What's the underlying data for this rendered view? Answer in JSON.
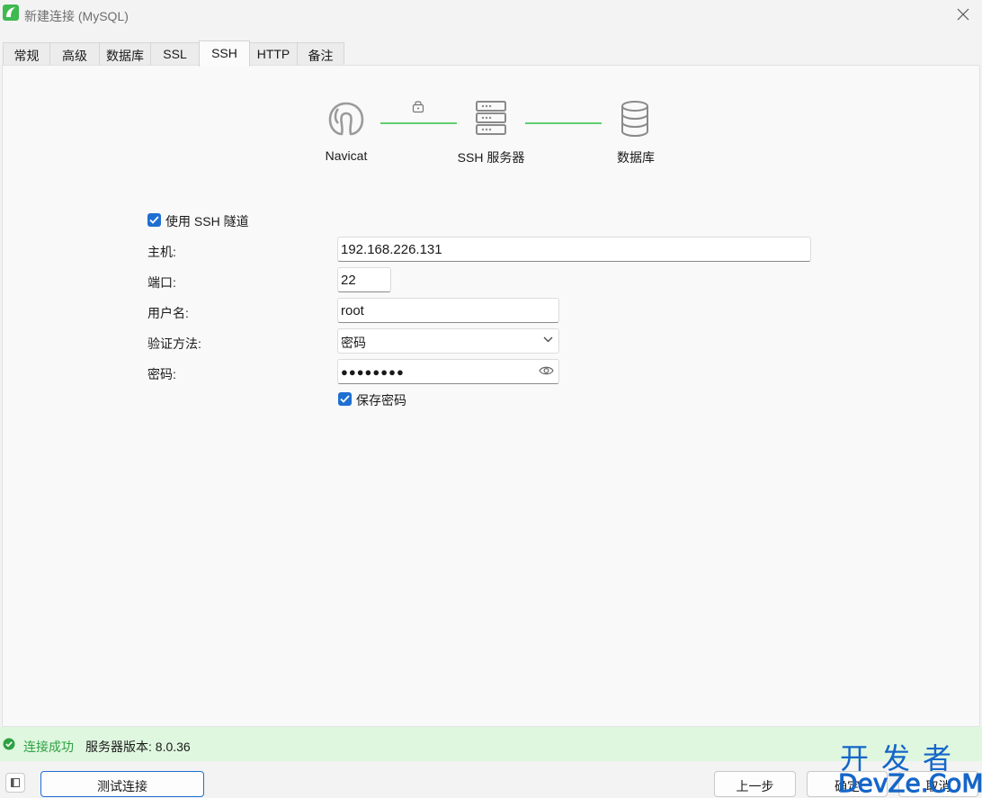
{
  "window": {
    "title": "新建连接 (MySQL)"
  },
  "tabs": [
    {
      "label": "常规"
    },
    {
      "label": "高级"
    },
    {
      "label": "数据库"
    },
    {
      "label": "SSL"
    },
    {
      "label": "SSH"
    },
    {
      "label": "HTTP"
    },
    {
      "label": "备注"
    }
  ],
  "active_tab": "SSH",
  "diagram": {
    "nodes": [
      {
        "label": "Navicat",
        "icon": "navicat-icon"
      },
      {
        "label": "SSH 服务器",
        "icon": "server-icon"
      },
      {
        "label": "数据库",
        "icon": "database-icon"
      }
    ],
    "link_icon": "lock-icon",
    "link_color": "#5fcf6f"
  },
  "form": {
    "use_ssh_label": "使用 SSH 隧道",
    "use_ssh_checked": true,
    "host_label": "主机:",
    "host_value": "192.168.226.131",
    "port_label": "端口:",
    "port_value": "22",
    "username_label": "用户名:",
    "username_value": "root",
    "auth_label": "验证方法:",
    "auth_value": "密码",
    "password_label": "密码:",
    "password_value": "●●●●●●●●",
    "save_password_label": "保存密码",
    "save_password_checked": true
  },
  "status": {
    "message": "连接成功",
    "version": "服务器版本: 8.0.36",
    "color": "#2ea043"
  },
  "buttons": {
    "test": "测试连接",
    "prev": "上一步",
    "ok": "确定",
    "cancel": "取消"
  },
  "watermark": {
    "top": "开发者",
    "bottom": "DevZe.CoM"
  },
  "colors": {
    "accent": "#1f6fd1",
    "success_bg": "#dff7df"
  }
}
